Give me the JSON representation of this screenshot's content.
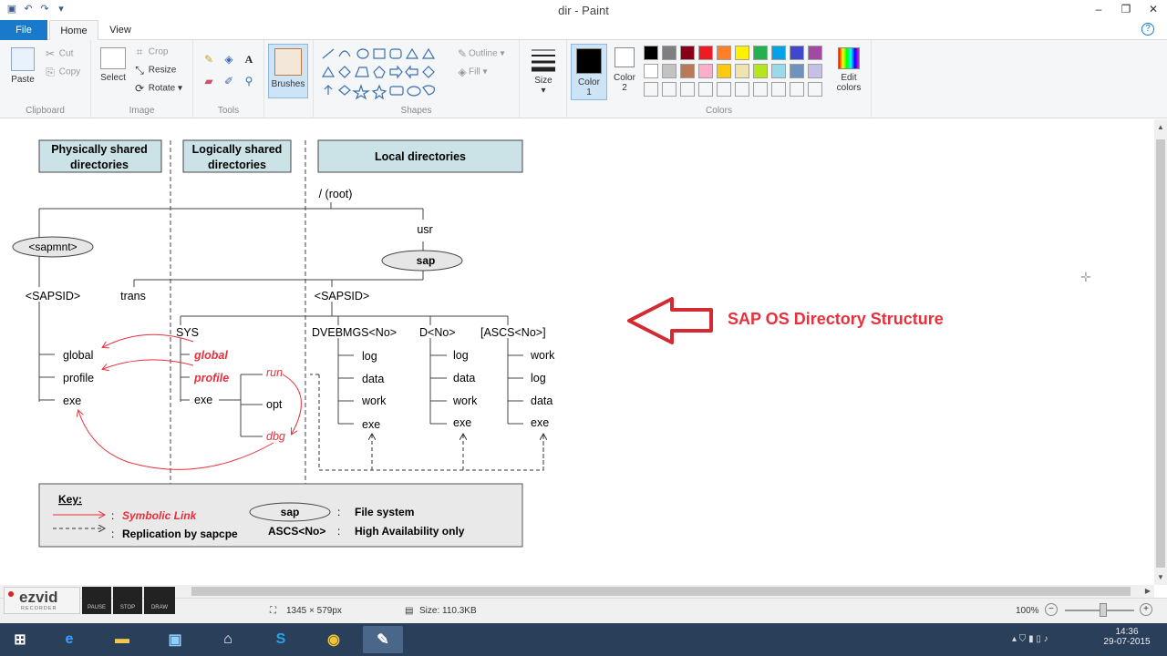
{
  "window": {
    "title": "dir - Paint"
  },
  "tabs": {
    "file": "File",
    "home": "Home",
    "view": "View"
  },
  "clipboard": {
    "group": "Clipboard",
    "paste": "Paste",
    "cut": "Cut",
    "copy": "Copy"
  },
  "image": {
    "group": "Image",
    "select": "Select",
    "crop": "Crop",
    "resize": "Resize",
    "rotate": "Rotate"
  },
  "tools": {
    "group": "Tools"
  },
  "brushes": {
    "label": "Brushes"
  },
  "shapes": {
    "group": "Shapes",
    "outline": "Outline",
    "fill": "Fill"
  },
  "size": {
    "label": "Size"
  },
  "colors": {
    "group": "Colors",
    "color1": "Color",
    "color1_num": "1",
    "color2": "Color",
    "color2_num": "2",
    "edit": "Edit",
    "edit2": "colors",
    "row1": [
      "#000000",
      "#7f7f7f",
      "#880015",
      "#ed1c24",
      "#ff7f27",
      "#fff200",
      "#22b14c",
      "#00a2e8",
      "#3f48cc",
      "#a349a4"
    ],
    "row2": [
      "#ffffff",
      "#c3c3c3",
      "#b97a57",
      "#ffaec9",
      "#ffc90e",
      "#efe4b0",
      "#b5e61d",
      "#99d9ea",
      "#7092be",
      "#c8bfe7"
    ]
  },
  "diagram": {
    "header_physical_1": "Physically shared",
    "header_physical_2": "directories",
    "header_logical_1": "Logically shared",
    "header_logical_2": "directories",
    "header_local": "Local directories",
    "root": "/ (root)",
    "usr": "usr",
    "sapmnt": "<sapmnt>",
    "sap": "sap",
    "sapsid_left": "<SAPSID>",
    "trans": "trans",
    "sapsid_mid": "<SAPSID>",
    "sys": "SYS",
    "global_left": "global",
    "profile_left": "profile",
    "exe_left": "exe",
    "global_link": "global",
    "profile_link": "profile",
    "exe_mid": "exe",
    "run": "run",
    "opt": "opt",
    "dbg": "dbg",
    "dvebmgs": "DVEBMGS<No>",
    "dno": "D<No>",
    "ascs": "[ASCS<No>]",
    "dv_items": [
      "log",
      "data",
      "work",
      "exe"
    ],
    "d_items": [
      "log",
      "data",
      "work",
      "exe"
    ],
    "ascs_items": [
      "work",
      "log",
      "data",
      "exe"
    ],
    "key_title": "Key:",
    "key_symlink": "Symbolic Link",
    "key_sap": "sap",
    "key_filesystem": "File system",
    "key_replication": "Replication by sapcpe",
    "key_ascs": "ASCS<No>",
    "key_ha": "High Availability only",
    "colon": ":",
    "callout": "SAP OS Directory Structure"
  },
  "status": {
    "dimensions": "1345 × 579px",
    "size": "Size: 110.3KB",
    "zoom": "100%"
  },
  "ezvid": {
    "logo": "ezvid",
    "sub": "RECORDER",
    "pause": "PAUSE",
    "stop": "STOP",
    "draw": "DRAW"
  },
  "clock": {
    "time": "14:36",
    "date": "29-07-2015"
  },
  "accent": "#1979ca",
  "link_color": "#e8303c"
}
